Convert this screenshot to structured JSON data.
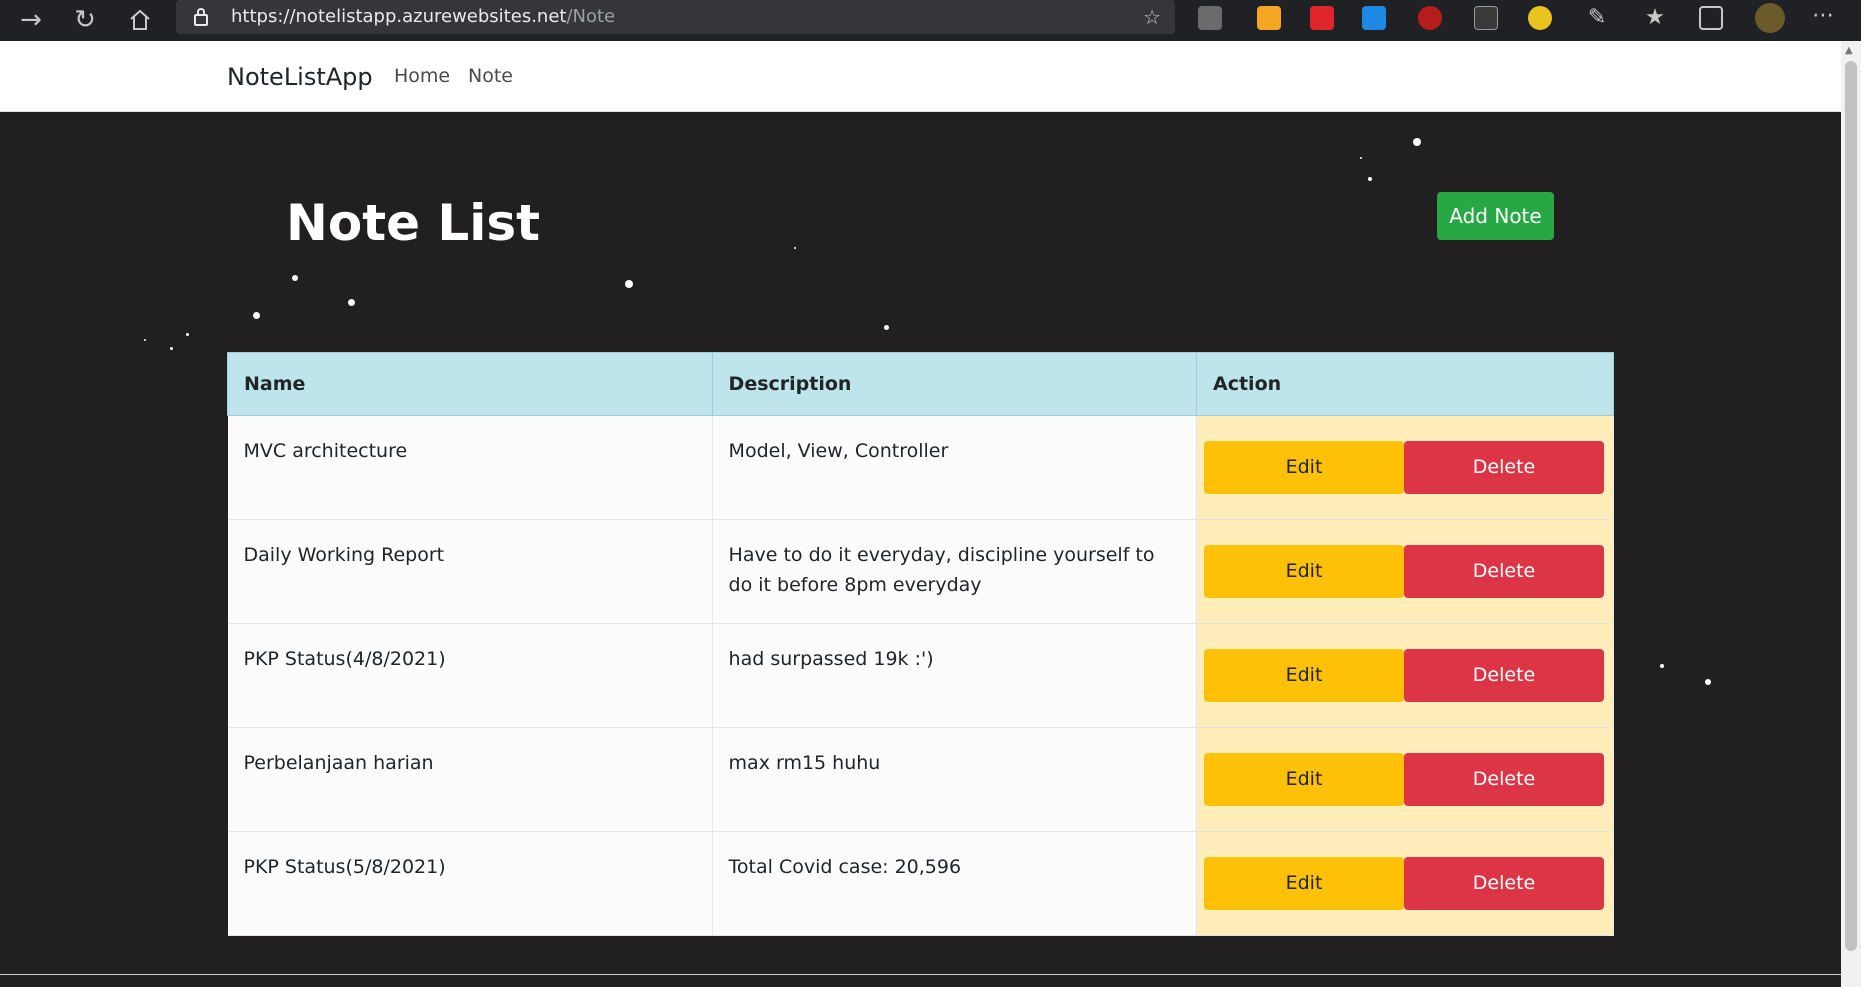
{
  "browser": {
    "url_host": "https://notelistapp.azurewebsites.net",
    "url_path": "/Note",
    "icons": [
      "forward-icon",
      "refresh-icon",
      "home-icon",
      "lock-icon",
      "add-favorite-icon",
      "favorites-icon",
      "collections-icon",
      "more-icon"
    ]
  },
  "navbar": {
    "brand": "NoteListApp",
    "links": [
      "Home",
      "Note"
    ]
  },
  "page": {
    "title": "Note List",
    "add_button": "Add Note"
  },
  "table": {
    "headers": [
      "Name",
      "Description",
      "Action"
    ],
    "rows": [
      {
        "name": "MVC architecture",
        "description": "Model, View, Controller"
      },
      {
        "name": "Daily Working Report",
        "description": "Have to do it everyday, discipline yourself to do it before 8pm everyday"
      },
      {
        "name": "PKP Status(4/8/2021)",
        "description": "had surpassed 19k :')"
      },
      {
        "name": "Perbelanjaan harian",
        "description": "max rm15 huhu"
      },
      {
        "name": "PKP Status(5/8/2021)",
        "description": "Total Covid case: 20,596"
      }
    ],
    "edit_label": "Edit",
    "delete_label": "Delete"
  },
  "colors": {
    "page_bg": "#221f20",
    "header_bg": "#bee5eb",
    "action_bg": "#ffeeba",
    "edit": "#ffc107",
    "delete": "#dc3545",
    "add": "#28a745"
  }
}
